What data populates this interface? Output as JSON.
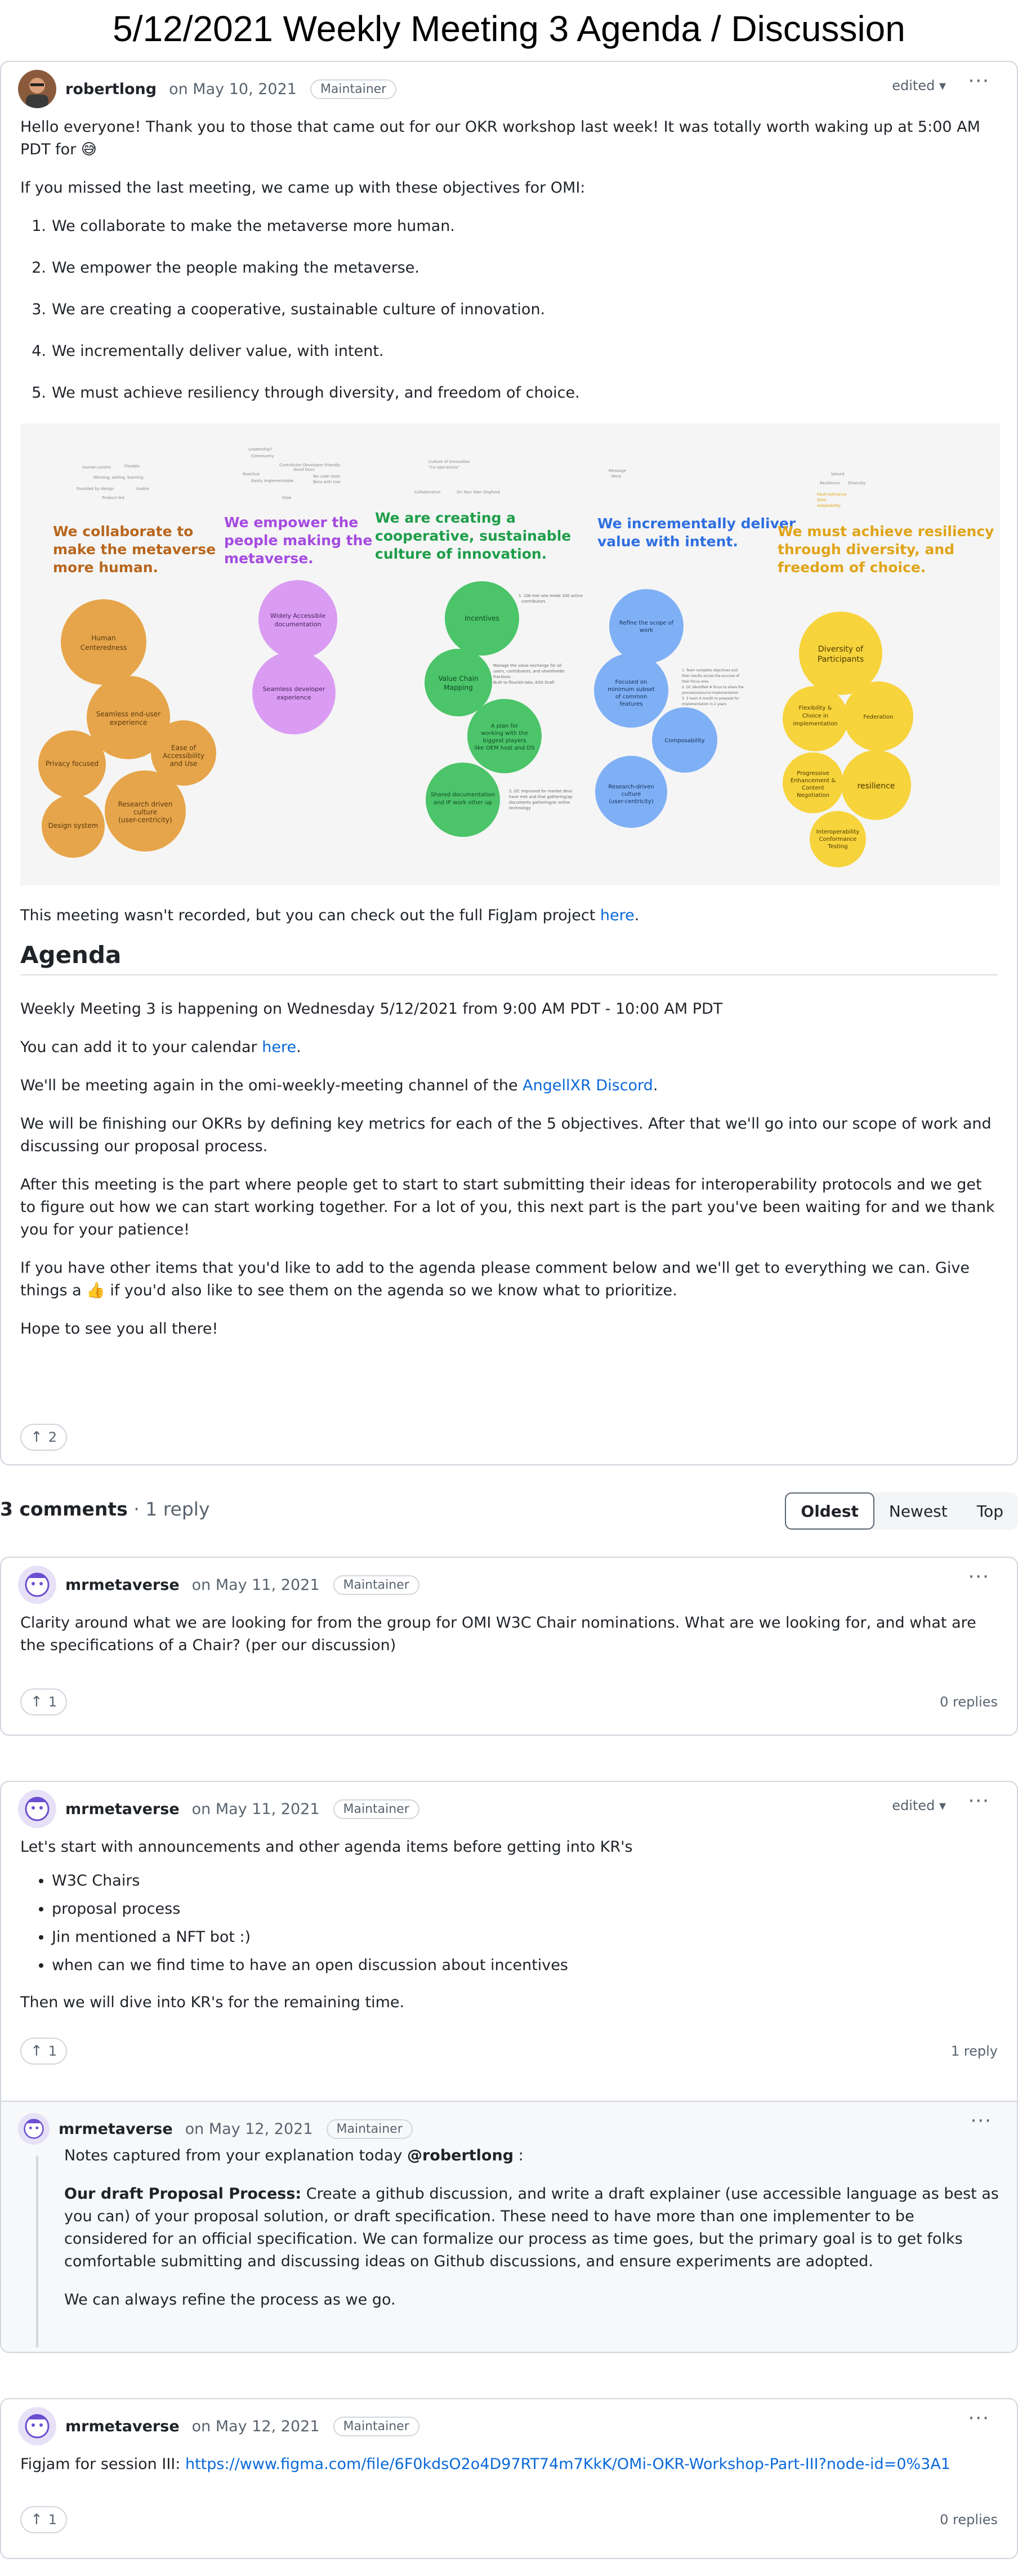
{
  "page": {
    "title": "5/12/2021 Weekly Meeting 3 Agenda / Discussion"
  },
  "post": {
    "author": "robertlong",
    "date": "on May 10, 2021",
    "badge": "Maintainer",
    "edited": "edited",
    "intro": "Hello everyone! Thank you to those that came out for our OKR workshop last week! It was totally worth waking up at 5:00 AM PDT for 😅",
    "missed": "If you missed the last meeting, we came up with these objectives for OMI:",
    "objectives": [
      "We collaborate to make the metaverse more human.",
      "We empower the people making the metaverse.",
      "We are creating a cooperative, sustainable culture of innovation.",
      "We incrementally deliver value, with intent.",
      "We must achieve resiliency through diversity, and freedom of choice."
    ],
    "figjam": {
      "headings": [
        "We collaborate to make the metaverse more human.",
        "We empower the people making the metaverse.",
        "We are creating a cooperative, sustainable culture of innovation.",
        "We incrementally deliver value with intent.",
        "We must achieve resiliency through diversity, and freedom of choice."
      ],
      "colors": [
        "#b8661d",
        "#a54be0",
        "#1e9e4a",
        "#2f6fe0",
        "#e0a418"
      ],
      "bubble_colors": [
        "#e6a54a",
        "#d99cf2",
        "#4cc46a",
        "#7fb0f5",
        "#f7d33c"
      ],
      "group1": [
        "Human Centeredness",
        "Seamless end-user experience",
        "Privacy focused",
        "Ease of Accessibility and Use",
        "Design system",
        "Research driven culture (user-centricity)"
      ],
      "group2": [
        "Widely Accessible documentation",
        "Seamless developer experience"
      ],
      "group3": [
        "Incentives",
        "Value Chain Mapping",
        "A plan for working with the biggest players like OEM host and DS",
        "Shared documentation and IP work other up"
      ],
      "group4": [
        "Refine the scope of work",
        "Focused on minimum subset of common features",
        "Composability",
        "Research driven culture (user-centricity)"
      ],
      "group5": [
        "Diversity of Participants",
        "Flexibility & Choice in implementation",
        "Federation",
        "Progressive Enhancement & Content Negotiation",
        "resilience",
        "Interoperability Conformance Testing"
      ]
    },
    "not_recorded_prefix": "This meeting wasn't recorded, but you can check out the full FigJam project ",
    "not_recorded_link": "here",
    "not_recorded_suffix": ".",
    "agenda_heading": "Agenda",
    "agenda_when": "Weekly Meeting 3 is happening on Wednesday 5/12/2021 from 9:00 AM PDT - 10:00 AM PDT",
    "calendar_prefix": "You can add it to your calendar ",
    "calendar_link": "here",
    "calendar_suffix": ".",
    "channel_prefix": "We'll be meeting again in the omi-weekly-meeting channel of the ",
    "channel_link": "AngellXR Discord",
    "channel_suffix": ".",
    "finishing": "We will be finishing our OKRs by defining key metrics for each of the 5 objectives. After that we'll go into our scope of work and discussing our proposal process.",
    "after": "After this meeting is the part where people get to start to start submitting their ideas for interoperability protocols and we get to figure out how we can start working together. For a lot of you, this next part is the part you've been waiting for and we thank you for your patience!",
    "other_items": "If you have other items that you'd like to add to the agenda please comment below and we'll get to everything we can. Give things a 👍 if you'd also like to see them on the agenda so we know what to prioritize.",
    "hope": "Hope to see you all there!",
    "upvotes": "2"
  },
  "comments_header": {
    "count": "3 comments",
    "replies": " · 1 reply"
  },
  "sort_tabs": [
    "Oldest",
    "Newest",
    "Top"
  ],
  "comments": [
    {
      "author": "mrmetaverse",
      "date": "on May 11, 2021",
      "badge": "Maintainer",
      "text": "Clarity around what we are looking for from the group for OMI W3C Chair nominations. What are we looking for, and what are the specifications of a Chair? (per our discussion)",
      "upvotes": "1",
      "replies": "0 replies"
    },
    {
      "author": "mrmetaverse",
      "date": "on May 11, 2021",
      "badge": "Maintainer",
      "edited": "edited",
      "intro": "Let's start with announcements and other agenda items before getting into KR's",
      "bullets": [
        "W3C Chairs",
        "proposal process",
        "Jin mentioned a NFT bot :)",
        "when can we find time to have an open discussion about incentives"
      ],
      "outro": "Then we will dive into KR's for the remaining time.",
      "upvotes": "1",
      "replies": "1 reply"
    },
    {
      "author": "mrmetaverse",
      "date": "on May 12, 2021",
      "badge": "Maintainer",
      "text": "Figjam for session III: ",
      "link": "https://www.figma.com/file/6F0kdsO2o4D97RT74m7KkK/OMi-OKR-Workshop-Part-III?node-id=0%3A1",
      "upvotes": "1",
      "replies": "0 replies"
    }
  ],
  "reply": {
    "author": "mrmetaverse",
    "date": "on May 12, 2021",
    "badge": "Maintainer",
    "notes_prefix": "Notes captured from your explanation today ",
    "mention": "@robertlong",
    "notes_suffix": " :",
    "draft_label": "Our draft Proposal Process:",
    "draft_text": " Create a github discussion, and write a draft explainer (use accessible language as best as you can) of your proposal solution, or draft specification. These need to have more than one implementer to be considered for an official specification. We can formalize our process as time goes, but the primary goal is to get folks comfortable submitting and discussing ideas on Github discussions, and ensure experiments are adopted.",
    "refine": "We can always refine the process as we go."
  }
}
